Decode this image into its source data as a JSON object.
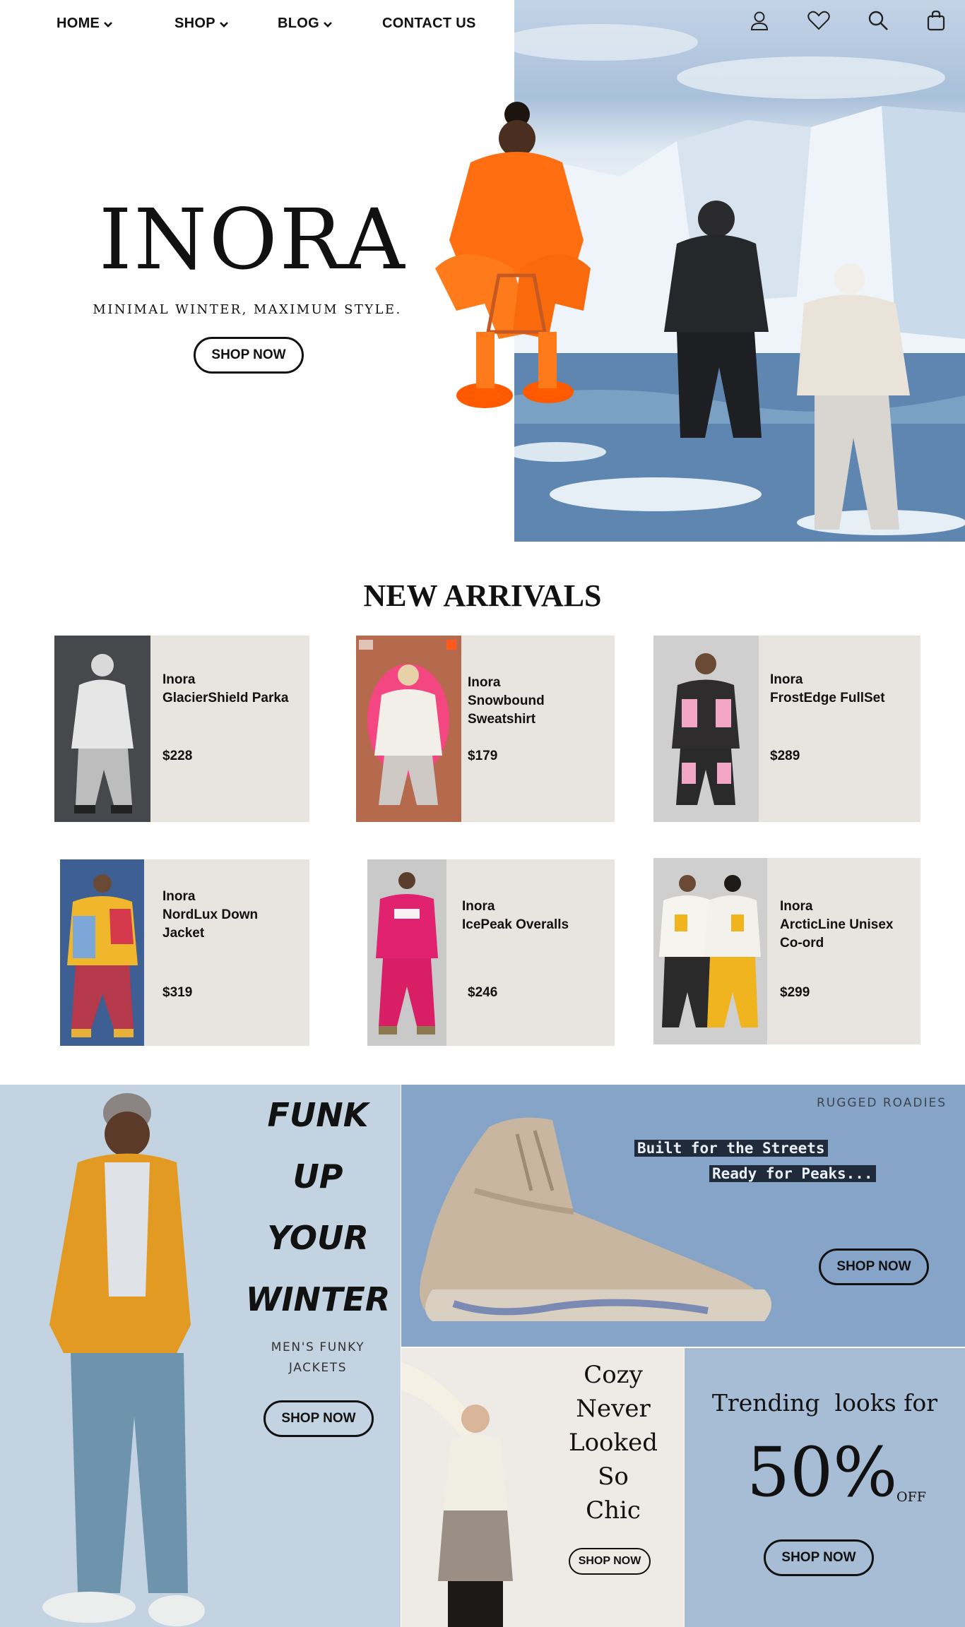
{
  "nav": {
    "items": [
      {
        "label": "HOME",
        "has_dropdown": true
      },
      {
        "label": "SHOP",
        "has_dropdown": true
      },
      {
        "label": "BLOG",
        "has_dropdown": true
      },
      {
        "label": "CONTACT US",
        "has_dropdown": false
      }
    ],
    "icons": [
      "user-icon",
      "heart-icon",
      "search-icon",
      "bag-icon"
    ]
  },
  "hero": {
    "brand": "INORA",
    "tagline": "MINIMAL WINTER, MAXIMUM STYLE.",
    "cta": "SHOP NOW"
  },
  "new_arrivals": {
    "title": "NEW ARRIVALS",
    "products": [
      {
        "name": "Inora\nGlacierShield Parka",
        "price": "$228"
      },
      {
        "name": "Inora\nSnowbound\nSweatshirt",
        "price": "$179"
      },
      {
        "name": "Inora\nFrostEdge FullSet",
        "price": "$289"
      },
      {
        "name": "Inora\nNordLux Down\nJacket",
        "price": "$319"
      },
      {
        "name": "Inora\nIcePeak Overalls",
        "price": "$246"
      },
      {
        "name": "Inora\nArcticLine Unisex\nCo-ord",
        "price": "$299"
      }
    ]
  },
  "promo_funk": {
    "headline": "FUNK\nUP\nYOUR\nWINTER",
    "subtitle": "MEN'S FUNKY\nJACKETS",
    "cta": "SHOP NOW"
  },
  "promo_boots": {
    "eyebrow": "RUGGED ROADIES",
    "line1": "Built for the Streets",
    "line2": "Ready for Peaks...",
    "cta": "SHOP NOW"
  },
  "promo_cozy": {
    "headline": "Cozy\nNever\nLooked\nSo\nChic",
    "cta": "SHOP NOW"
  },
  "promo_sale": {
    "headline": "Trending  looks for",
    "percent": "50%",
    "off": "OFF",
    "cta": "SHOP NOW"
  },
  "colors": {
    "card_bg": "#e8e5e1",
    "funk_bg": "#c3d3e1",
    "boots_bg": "#86a4c7",
    "cozy_bg": "#eeebe7",
    "sale_bg": "#a7bdd6"
  }
}
